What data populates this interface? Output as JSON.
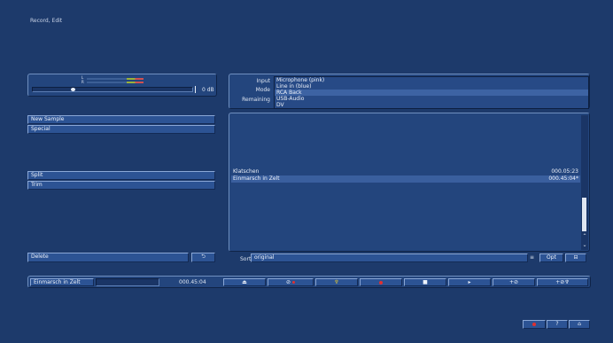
{
  "window": {
    "title": "Record, Edit"
  },
  "level": {
    "meter_left_label": "L",
    "meter_right_label": "R",
    "gain_value": "0 dB",
    "slider_level": 0.25
  },
  "buttons": {
    "new_sample": "New Sample",
    "special": "Special",
    "split": "Split",
    "trim": "Trim",
    "delete": "Delete"
  },
  "settings": {
    "input_label": "Input",
    "mode_label": "Mode",
    "remaining_label": "Remaining",
    "input_options": [
      "Microphone (pink)",
      "Line in (blue)",
      "RCA Back",
      "USB-Audio",
      "DV"
    ],
    "selected_index": 2
  },
  "samples": [
    {
      "name": "Klatschen",
      "duration": "000.05:23"
    },
    {
      "name": "Einmarsch in Zelt",
      "duration": "000.45:04*"
    }
  ],
  "sort": {
    "label": "Sort",
    "value": "original",
    "opt_label": "Opt"
  },
  "transport": {
    "current_name": "Einmarsch in Zelt",
    "time": "000.45:04"
  },
  "colors": {
    "background": "#1d3a6b",
    "record_red": "#e03030",
    "accent_yellow": "#d8c23a"
  }
}
